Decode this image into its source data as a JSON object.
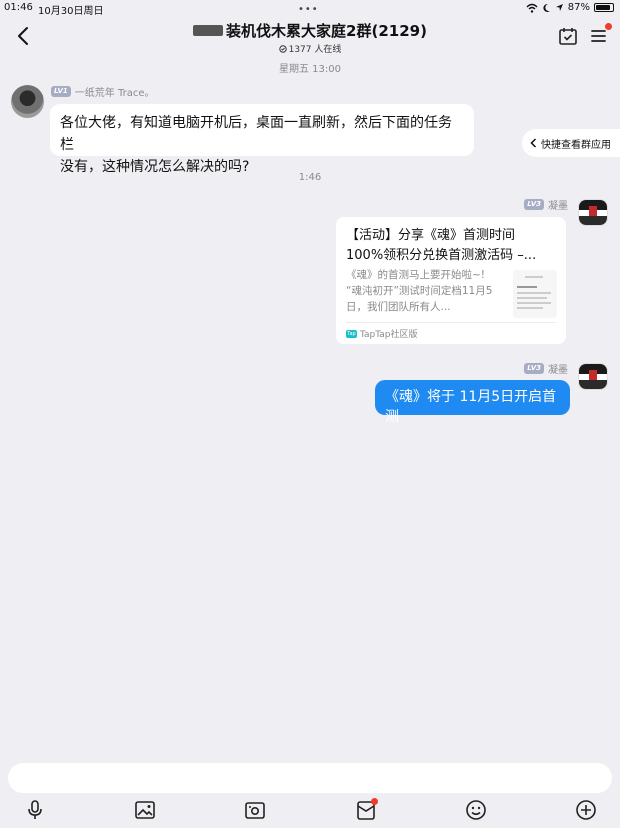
{
  "status_bar": {
    "time": "01:46",
    "date": "10月30日周日",
    "battery": "87%",
    "battery_level": 0.87
  },
  "header": {
    "title": "装机伐木累大家庭2群(2129)",
    "online": "1377 人在线"
  },
  "quick_app": {
    "label": "快捷查看群应用"
  },
  "messages": {
    "ts1": "星期五 13:00",
    "m1": {
      "level": "LV1",
      "sender": "一纸荒年 Trace。",
      "text_line1": "各位大佬，有知道电脑开机后，桌面一直刷新，然后下面的任务栏",
      "text_line2": "没有，这种情况怎么解决的吗?"
    },
    "ts2": "1:46",
    "m2": {
      "level": "LV3",
      "sender": "凝墨",
      "card": {
        "title_line1": "【活动】分享《魂》首测时间",
        "title_line2": "100%领积分兑换首测激活码 –...",
        "desc_line1": "《魂》的首测马上要开始啦~!",
        "desc_line2": "“魂沌初开”测试时间定档11月5",
        "desc_line3": "日，我们团队所有人...",
        "source_icon": "Tap",
        "source": "TapTap社区版"
      }
    },
    "m3": {
      "level": "LV3",
      "sender": "凝墨",
      "text": "《魂》将于 11月5日开启首测"
    }
  },
  "colors": {
    "accent": "#1f8bf2",
    "background": "#efeff3",
    "badge": "#f23a2f"
  }
}
